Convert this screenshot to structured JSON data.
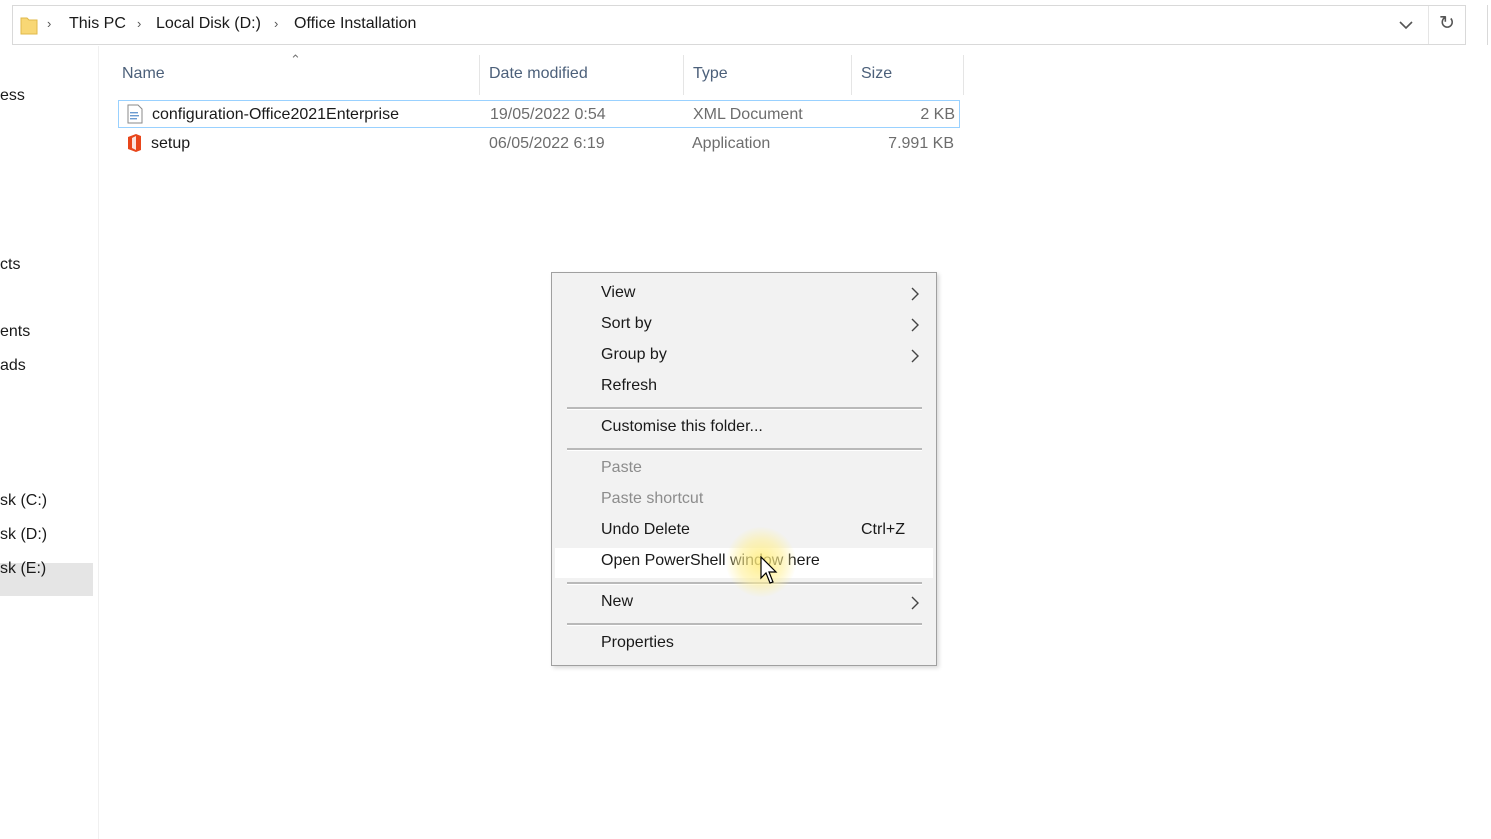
{
  "address_bar": {
    "breadcrumbs": [
      "This PC",
      "Local Disk (D:)",
      "Office Installation"
    ],
    "icons": [
      "folder-icon",
      "chevron-down-icon",
      "refresh-icon"
    ]
  },
  "sidebar": {
    "items": [
      "ess",
      "cts",
      "ents",
      "ads",
      "sk (C:)",
      "sk (D:)",
      "sk (E:)"
    ],
    "selected": "sk (D:)"
  },
  "columns": [
    "Name",
    "Date modified",
    "Type",
    "Size"
  ],
  "files": [
    {
      "name": "configuration-Office2021Enterprise",
      "date": "19/05/2022 0:54",
      "type": "XML Document",
      "size": "2 KB",
      "icon": "xml-document-icon"
    },
    {
      "name": "setup",
      "date": "06/05/2022 6:19",
      "type": "Application",
      "size": "7.991 KB",
      "icon": "office-app-icon"
    }
  ],
  "context_menu": {
    "items": [
      {
        "label": "View",
        "submenu": true
      },
      {
        "label": "Sort by",
        "submenu": true
      },
      {
        "label": "Group by",
        "submenu": true
      },
      {
        "label": "Refresh"
      },
      {
        "label": "Customise this folder..."
      },
      {
        "label": "Paste",
        "disabled": true
      },
      {
        "label": "Paste shortcut",
        "disabled": true
      },
      {
        "label": "Undo Delete",
        "shortcut": "Ctrl+Z"
      },
      {
        "label": "Open PowerShell window here",
        "hovered": true
      },
      {
        "label": "New",
        "submenu": true
      },
      {
        "label": "Properties"
      }
    ]
  },
  "colors": {
    "selection_border": "#99d1ff",
    "menu_background": "#f2f2f2",
    "office_orange": "#e8461b",
    "cursor_highlight": "#ffe878"
  }
}
